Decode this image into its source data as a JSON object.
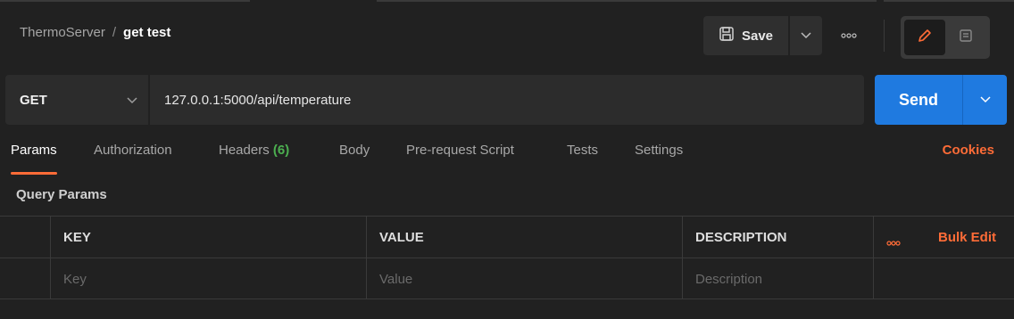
{
  "breadcrumb": {
    "parent": "ThermoServer",
    "separator": "/",
    "current": "get test"
  },
  "toolbar": {
    "save_label": "Save",
    "icons": {
      "save": "save-icon",
      "caret": "chevron-down-icon",
      "more": "more-icon",
      "edit": "pencil-icon",
      "doc": "document-icon"
    }
  },
  "request": {
    "method": "GET",
    "url": "127.0.0.1:5000/api/temperature",
    "send_label": "Send"
  },
  "tabs": [
    {
      "label": "Params",
      "active": true
    },
    {
      "label": "Authorization"
    },
    {
      "label": "Headers",
      "count": "(6)"
    },
    {
      "label": "Body"
    },
    {
      "label": "Pre-request Script"
    },
    {
      "label": "Tests"
    },
    {
      "label": "Settings"
    }
  ],
  "cookies_label": "Cookies",
  "query_params": {
    "title": "Query Params",
    "columns": {
      "key": "KEY",
      "value": "VALUE",
      "description": "DESCRIPTION"
    },
    "bulk_edit": "Bulk Edit",
    "placeholders": {
      "key": "Key",
      "value": "Value",
      "description": "Description"
    }
  },
  "colors": {
    "accent": "#ff6c37",
    "send": "#1f7ae0",
    "count": "#4caf50",
    "background": "#212121"
  }
}
